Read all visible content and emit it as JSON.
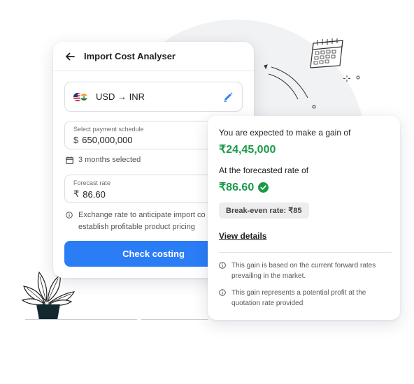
{
  "analyser": {
    "title": "Import Cost Analyser",
    "currency_pair": "USD → INR",
    "schedule": {
      "label": "Select payment schedule",
      "symbol": "$",
      "value": "650,000,000"
    },
    "months_selected": "3 months selected",
    "rate": {
      "label": "Forecast rate",
      "symbol": "₹",
      "value": "86.60"
    },
    "note": "Exchange rate to anticipate import co",
    "note_line2": "establish profitable product pricing",
    "cta_label": "Check costing"
  },
  "result": {
    "gain_intro": "You are expected to make a gain of",
    "gain_amount": "₹24,45,000",
    "rate_intro": "At the forecasted rate of",
    "rate_value": "₹86.60",
    "break_even": "Break-even rate: ₹85",
    "view_details": "View details",
    "footnotes": [
      "This gain is based on the current forward rates prevailing in the market.",
      "This gain represents a potential profit at the quotation rate provided"
    ]
  },
  "colors": {
    "accent": "#2b7df6",
    "gain": "#1b9a4a"
  },
  "icons": [
    "back-arrow-icon",
    "us-flag-icon",
    "india-flag-icon",
    "edit-pencil-icon",
    "calendar-icon",
    "info-icon",
    "check-circle-icon",
    "calendar-illustration-icon",
    "plant-illustration-icon"
  ]
}
